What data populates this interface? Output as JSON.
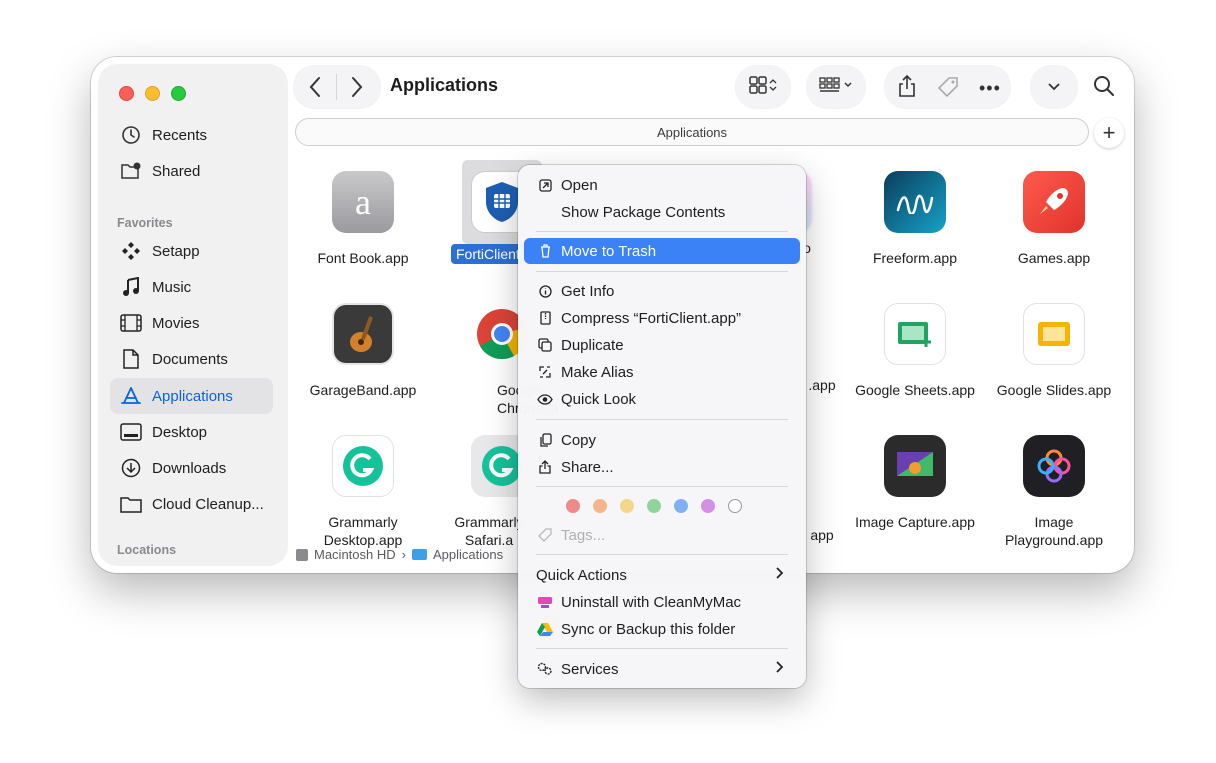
{
  "window": {
    "title": "Applications",
    "path_bar": "Applications"
  },
  "sidebar": {
    "items_top": [
      {
        "label": "Recents",
        "icon": "clock-icon"
      },
      {
        "label": "Shared",
        "icon": "shared-folder-icon"
      }
    ],
    "favorites_header": "Favorites",
    "favorites": [
      {
        "label": "Setapp",
        "icon": "setapp-icon"
      },
      {
        "label": "Music",
        "icon": "music-note-icon"
      },
      {
        "label": "Movies",
        "icon": "film-icon"
      },
      {
        "label": "Documents",
        "icon": "document-icon"
      },
      {
        "label": "Applications",
        "icon": "applications-icon"
      },
      {
        "label": "Desktop",
        "icon": "desktop-icon"
      },
      {
        "label": "Downloads",
        "icon": "download-icon"
      },
      {
        "label": "Cloud Cleanup...",
        "icon": "folder-icon"
      }
    ],
    "locations_header": "Locations"
  },
  "apps": [
    {
      "label": "Font Book.app"
    },
    {
      "label": "FortiClient"
    },
    {
      "label": "o"
    },
    {
      "label": "Freeform.app"
    },
    {
      "label": "Games.app"
    },
    {
      "label": "GarageBand.app"
    },
    {
      "label": "Google Chrome.a"
    },
    {
      "label": ".app"
    },
    {
      "label": "Google Sheets.app"
    },
    {
      "label": "Google Slides.app"
    },
    {
      "label": "Grammarly Desktop.app"
    },
    {
      "label": "Grammarly Safari.a"
    },
    {
      "label": "app"
    },
    {
      "label": "Image Capture.app"
    },
    {
      "label": "Image Playground.app"
    }
  ],
  "status_bar": {
    "disk": "Macintosh HD",
    "separator": "›",
    "folder": "Applications"
  },
  "context_menu": {
    "open": "Open",
    "show_package": "Show Package Contents",
    "move_to_trash": "Move to Trash",
    "get_info": "Get Info",
    "compress": "Compress “FortiClient.app”",
    "duplicate": "Duplicate",
    "make_alias": "Make Alias",
    "quick_look": "Quick Look",
    "copy": "Copy",
    "share": "Share...",
    "tags": "Tags...",
    "quick_actions": "Quick Actions",
    "uninstall": "Uninstall with CleanMyMac",
    "sync": "Sync or Backup this folder",
    "services": "Services",
    "tag_colors": [
      "#f08a8a",
      "#f5b48a",
      "#f3d68a",
      "#8fd49a",
      "#7fb1f2",
      "#d38ee8",
      "#ffffff"
    ]
  },
  "colors": {
    "accent": "#0a63d8",
    "highlight": "#3b82f6"
  }
}
